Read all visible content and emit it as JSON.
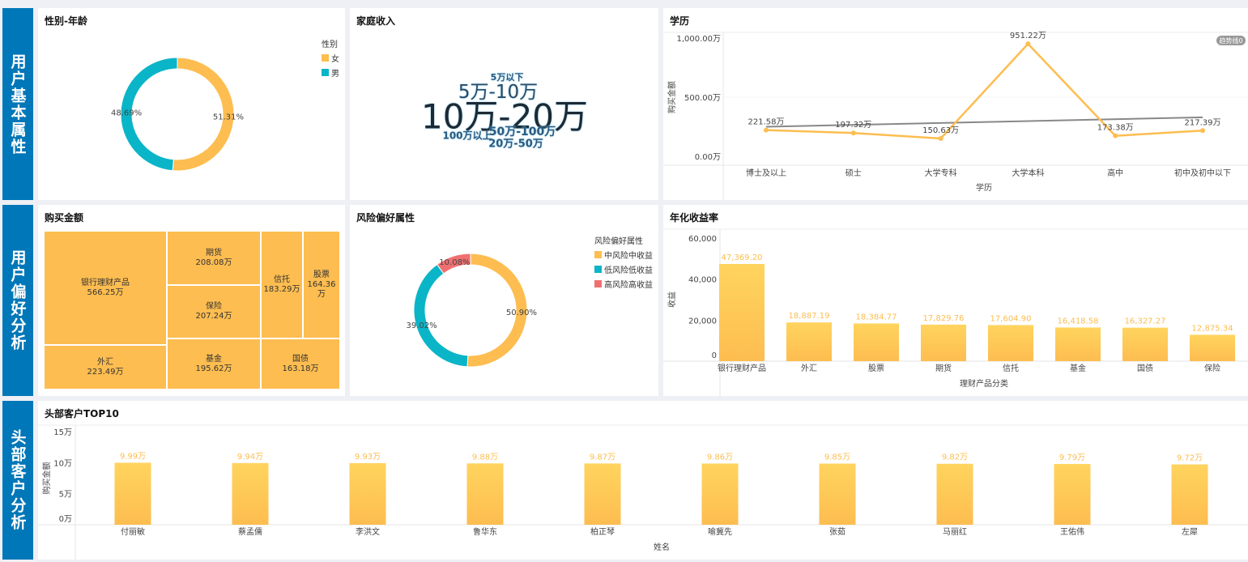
{
  "sections": [
    "用户基本属性",
    "用户偏好分析",
    "头部客户分析"
  ],
  "gender": {
    "title": "性别-年龄",
    "legend_title": "性别",
    "items": [
      {
        "label": "女",
        "value": 51.31,
        "text": "51.31%",
        "color": "#fdbd50"
      },
      {
        "label": "男",
        "value": 48.69,
        "text": "48.69%",
        "color": "#0ab5c8"
      }
    ]
  },
  "income": {
    "title": "家庭收入",
    "words": [
      "10万-20万",
      "5万-10万",
      "5万以下",
      "100万以上",
      "50万-100万",
      "20万-50万"
    ]
  },
  "education": {
    "title": "学历",
    "xlabel": "学历",
    "ylabel": "购买金额",
    "trend_tag": "趋势线0",
    "yticks": [
      "1,000.00万",
      "500.00万",
      "0.00万"
    ],
    "chart_data": {
      "type": "line",
      "categories": [
        "博士及以上",
        "硕士",
        "大学专科",
        "大学本科",
        "高中",
        "初中及初中以下"
      ],
      "values": [
        221.58,
        197.32,
        150.63,
        951.22,
        173.38,
        217.39
      ],
      "labels": [
        "221.58万",
        "197.32万",
        "150.63万",
        "951.22万",
        "173.38万",
        "217.39万"
      ],
      "ylim": [
        0,
        1000
      ],
      "trend": [
        250,
        330
      ]
    }
  },
  "purchase": {
    "title": "购买金额",
    "items": [
      {
        "label": "银行理财产品",
        "value": "566.25万"
      },
      {
        "label": "外汇",
        "value": "223.49万"
      },
      {
        "label": "期货",
        "value": "208.08万"
      },
      {
        "label": "保险",
        "value": "207.24万"
      },
      {
        "label": "基金",
        "value": "195.62万"
      },
      {
        "label": "信托",
        "value": "183.29万"
      },
      {
        "label": "股票",
        "value": "164.36万"
      },
      {
        "label": "国债",
        "value": "163.18万"
      }
    ]
  },
  "risk": {
    "title": "风险偏好属性",
    "legend_title": "风险偏好属性",
    "items": [
      {
        "label": "中风险中收益",
        "value": 50.9,
        "text": "50.90%",
        "color": "#fdbd50"
      },
      {
        "label": "低风险低收益",
        "value": 39.02,
        "text": "39.02%",
        "color": "#0ab5c8"
      },
      {
        "label": "高风险高收益",
        "value": 10.08,
        "text": "10.08%",
        "color": "#f07070"
      }
    ]
  },
  "annual": {
    "title": "年化收益率",
    "xlabel": "理财产品分类",
    "ylabel": "收益",
    "yticks": [
      "60,000",
      "40,000",
      "20,000",
      "0"
    ],
    "chart_data": {
      "type": "bar",
      "categories": [
        "银行理财产品",
        "外汇",
        "股票",
        "期货",
        "信托",
        "基金",
        "国债",
        "保险"
      ],
      "values": [
        47369.2,
        18887.19,
        18384.77,
        17829.76,
        17604.9,
        16418.58,
        16327.27,
        12875.34
      ],
      "labels": [
        "47,369.20",
        "18,887.19",
        "18,384.77",
        "17,829.76",
        "17,604.90",
        "16,418.58",
        "16,327.27",
        "12,875.34"
      ],
      "ylim": [
        0,
        60000
      ]
    }
  },
  "top10": {
    "title": "头部客户TOP10",
    "xlabel": "姓名",
    "ylabel": "购买金额",
    "yticks": [
      "15万",
      "10万",
      "5万",
      "0万"
    ],
    "chart_data": {
      "type": "bar",
      "categories": [
        "付丽敏",
        "蔡孟儒",
        "李洪文",
        "鲁华东",
        "柏正琴",
        "喻冀先",
        "张茹",
        "马丽红",
        "王佑伟",
        "左犀"
      ],
      "values": [
        9.99,
        9.94,
        9.93,
        9.88,
        9.87,
        9.86,
        9.85,
        9.82,
        9.79,
        9.72
      ],
      "labels": [
        "9.99万",
        "9.94万",
        "9.93万",
        "9.88万",
        "9.87万",
        "9.86万",
        "9.85万",
        "9.82万",
        "9.79万",
        "9.72万"
      ],
      "ylim": [
        0,
        15
      ]
    }
  }
}
